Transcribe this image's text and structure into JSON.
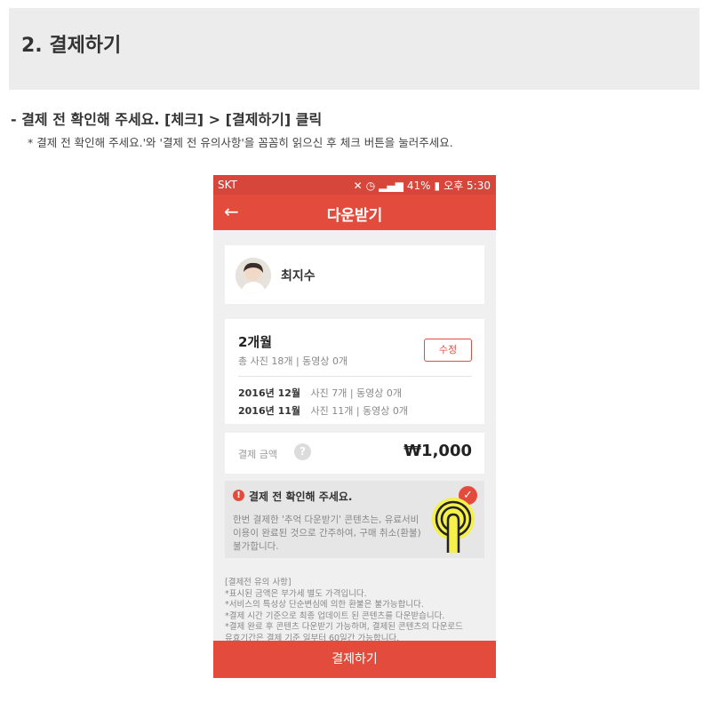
{
  "page": {
    "section_title": "2. 결제하기",
    "instruction_title": "- 결제 전 확인해 주세요. [체크] > [결제하기] 클릭",
    "instruction_note": "* 결제 전 확인해 주세요.'와 '결제 전 유의사항'을 꼼꼼히 읽으신 후 체크 버튼을 눌러주세요."
  },
  "status_bar": {
    "carrier": "SKT",
    "battery": "41%",
    "time": "오후 5:30"
  },
  "app_bar": {
    "title": "다운받기"
  },
  "user": {
    "name": "최지수"
  },
  "plan": {
    "title": "2개월",
    "summary": "총 사진 18개 | 동영상 0개",
    "edit_label": "수정",
    "months": [
      {
        "month": "2016년 12월",
        "detail": "사진 7개 | 동영상 0개"
      },
      {
        "month": "2016년 11월",
        "detail": "사진 11개 | 동영상 0개"
      }
    ]
  },
  "payment": {
    "label": "결제 금액",
    "help": "?",
    "amount": "₩1,000"
  },
  "confirm": {
    "title": "결제 전 확인해 주세요.",
    "body_lines": [
      "한번 결제한 '추억 다운받기' 콘텐츠는, 유료서비",
      "이용이 완료된 것으로 간주하여, 구매 취소(환불)",
      "불가합니다."
    ]
  },
  "notes": {
    "lines": [
      "[결제전 유의 사항]",
      "*표시된 금액은 부가세 별도 가격입니다.",
      "*서비스의 특성상 단순변심에 의한 환불은 불가능합니다.",
      "*결제 시간 기준으로 최종 업데이트 된 콘텐츠를 다운받습니다.",
      "*결제 완료 후 콘텐츠 다운받기 가능하며, 결제된 콘텐츠의 다운로드",
      "유효기간은 결제 기준 일부터 60일간 가능합니다."
    ]
  },
  "pay_button": {
    "label": "결제하기"
  },
  "colors": {
    "accent": "#e34c3c",
    "status_bar": "#d7463a",
    "tap_highlight": "#f5f04a"
  },
  "icons": {
    "back": "arrow-left-icon",
    "check": "check-icon",
    "warning": "exclamation-icon",
    "tap": "finger-tap-icon"
  }
}
